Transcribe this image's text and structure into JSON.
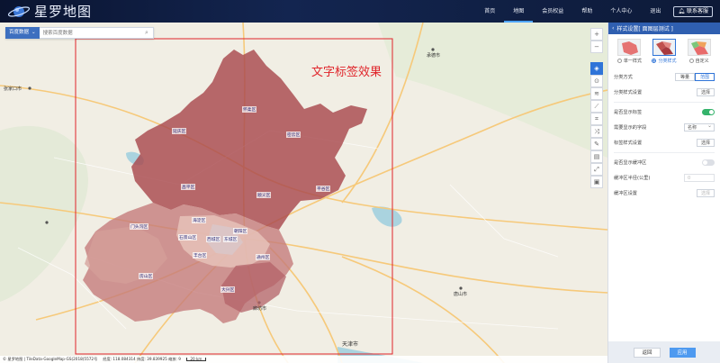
{
  "app": {
    "title": "星罗地图"
  },
  "nav": {
    "items": [
      "首页",
      "地图",
      "会员权益",
      "帮助",
      "个人中心",
      "退出"
    ],
    "active_index": 1,
    "contact": "联系客服"
  },
  "search": {
    "source": "百度数据",
    "placeholder": "搜索百度数据"
  },
  "map": {
    "annotation": "文字标签效果",
    "district_labels": [
      "怀柔区",
      "延庆区",
      "密云区",
      "昌平区",
      "顺义区",
      "平谷区",
      "门头沟区",
      "海淀区",
      "朝阳区",
      "石景山区",
      "西城区",
      "东城区",
      "丰台区",
      "通州区",
      "房山区",
      "大兴区"
    ],
    "place_labels": [
      "承德市",
      "张家口市",
      "廊坊市",
      "天津市",
      "唐山市"
    ],
    "colors": {
      "frame": "#e0242a",
      "region_dark": "#a8494e",
      "region_mid": "#c47a7a",
      "region_light": "#e6c2b8",
      "annotation": "#e0242a"
    }
  },
  "status": {
    "copyright": "© 星罗地图 | TileData-GoogleMap-GS(2018)5572号",
    "coords": "经度: 118.084314  纬度: 39.839925  缩放: 9",
    "scale": "20 km"
  },
  "panel": {
    "header": "样式设置[ 面图层测试 ]",
    "styles": [
      {
        "label": "单一样式",
        "selected": false
      },
      {
        "label": "分类样式",
        "selected": true
      },
      {
        "label": "自定义",
        "selected": false
      }
    ],
    "rows": {
      "classify_method": {
        "label": "分类方式",
        "options": [
          "等量",
          "范围"
        ],
        "active": 1
      },
      "classify_style": {
        "label": "分类样式设置",
        "button": "选择"
      },
      "show_label": {
        "label": "是否显示标签",
        "on": true
      },
      "label_field": {
        "label": "需要显示的字段",
        "value": "名称"
      },
      "label_style": {
        "label": "标签样式设置",
        "button": "选择"
      },
      "show_buffer": {
        "label": "是否显示缓冲区",
        "on": false
      },
      "buffer_radius": {
        "label": "缓冲区半径(公里)",
        "value": "0"
      },
      "buffer_style": {
        "label": "缓冲区设置",
        "button": "选择"
      }
    },
    "footer": {
      "reset": "返回",
      "apply": "应用"
    }
  }
}
